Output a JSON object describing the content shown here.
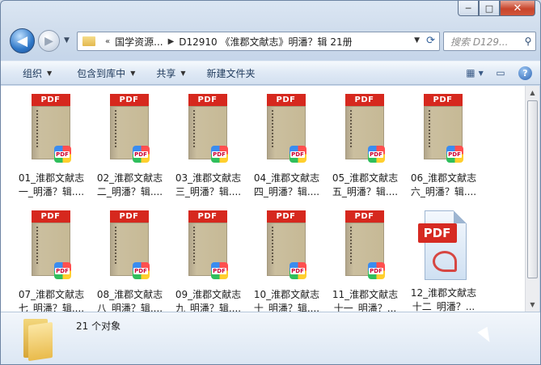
{
  "window": {
    "caption_buttons": {
      "minimize": "─",
      "maximize": "□",
      "close": "✕"
    }
  },
  "nav": {
    "back_glyph": "◀",
    "forward_glyph": "▶",
    "history_glyph": "▼",
    "breadcrumb": {
      "overflow": "«",
      "items": [
        "国学资源...",
        "D12910 《淮郡文献志》明潘？辑 21册"
      ],
      "separator": "▶"
    },
    "search_placeholder": "搜索 D129...",
    "search_icon": "search-icon"
  },
  "toolbar": {
    "organize": "组织",
    "include_in_library": "包含到库中",
    "share": "共享",
    "new_folder": "新建文件夹",
    "view_icon": "view-options-icon",
    "preview_icon": "preview-pane-icon",
    "help_label": "?"
  },
  "files": [
    {
      "line1": "01_淮郡文献志",
      "line2": "一_明潘？辑....",
      "type": "pdf-book"
    },
    {
      "line1": "02_淮郡文献志",
      "line2": "二_明潘？辑....",
      "type": "pdf-book"
    },
    {
      "line1": "03_淮郡文献志",
      "line2": "三_明潘？辑....",
      "type": "pdf-book"
    },
    {
      "line1": "04_淮郡文献志",
      "line2": "四_明潘？辑....",
      "type": "pdf-book"
    },
    {
      "line1": "05_淮郡文献志",
      "line2": "五_明潘？辑....",
      "type": "pdf-book"
    },
    {
      "line1": "06_淮郡文献志",
      "line2": "六_明潘？辑....",
      "type": "pdf-book"
    },
    {
      "line1": "07_淮郡文献志",
      "line2": "七_明潘？辑....",
      "type": "pdf-book"
    },
    {
      "line1": "08_淮郡文献志",
      "line2": "八_明潘？辑....",
      "type": "pdf-book"
    },
    {
      "line1": "09_淮郡文献志",
      "line2": "九_明潘？辑....",
      "type": "pdf-book"
    },
    {
      "line1": "10_淮郡文献志",
      "line2": "十_明潘？辑....",
      "type": "pdf-book"
    },
    {
      "line1": "11_淮郡文献志",
      "line2": "十一_明潘？...",
      "type": "pdf-book"
    },
    {
      "line1": "12_淮郡文献志",
      "line2": "十二_明潘？...",
      "type": "pdf-generic"
    }
  ],
  "pdf_tag": "PDF",
  "details": {
    "count_text": "21 个对象"
  },
  "colors": {
    "pdf_red": "#d6281e",
    "toolbar_text": "#1e395b"
  }
}
